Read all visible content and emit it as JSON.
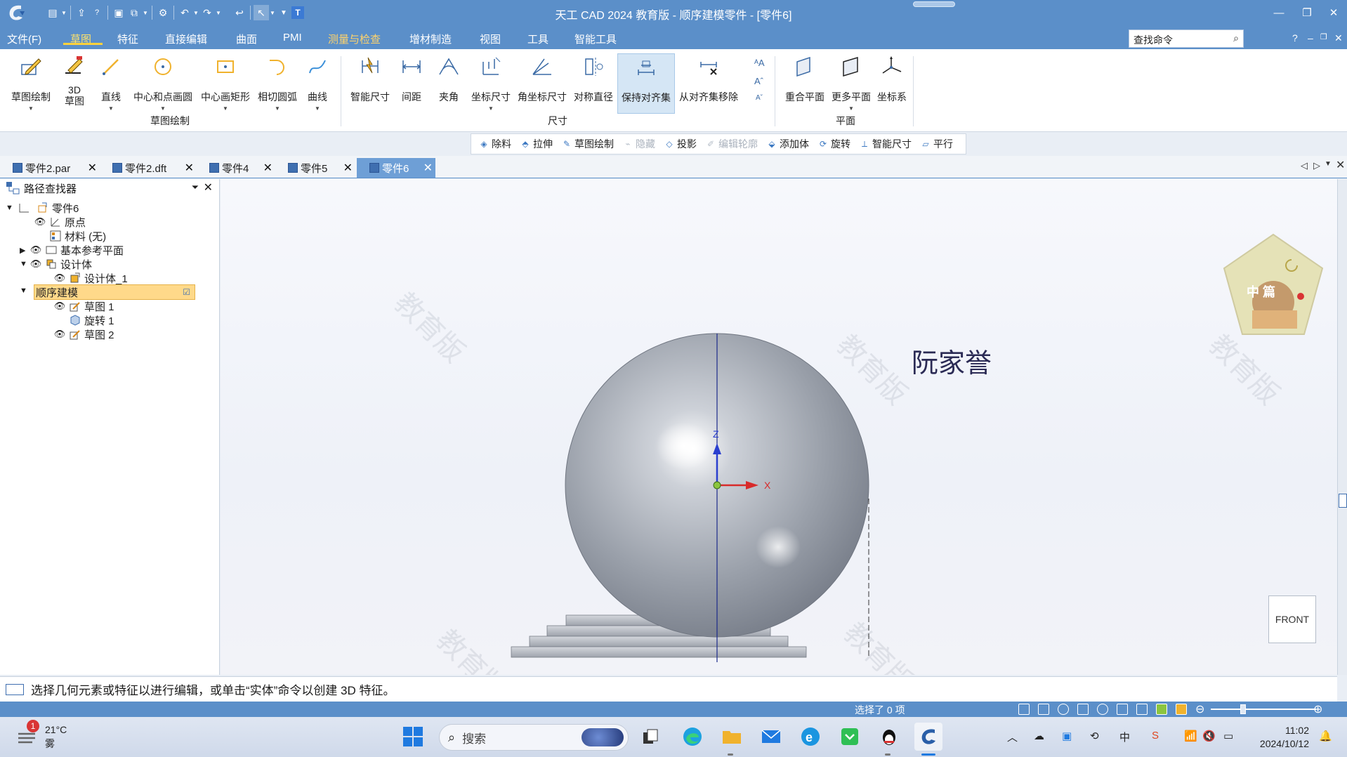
{
  "window": {
    "title": "天工 CAD 2024 教育版 - 顺序建模零件 - [零件6]"
  },
  "menu": {
    "items": [
      {
        "label": "文件(F)"
      },
      {
        "label": "草图"
      },
      {
        "label": "特征"
      },
      {
        "label": "直接编辑"
      },
      {
        "label": "曲面"
      },
      {
        "label": "PMI"
      },
      {
        "label": "测量与检查"
      },
      {
        "label": "增材制造"
      },
      {
        "label": "视图"
      },
      {
        "label": "工具"
      },
      {
        "label": "智能工具"
      }
    ],
    "search_placeholder": "查找命令",
    "help": "?"
  },
  "ribbon": {
    "sketch_group": {
      "label": "草图绘制",
      "buttons": [
        {
          "label": "草图绘制"
        },
        {
          "label": "3D\n草图"
        },
        {
          "label": "直线"
        },
        {
          "label": "中心和点画圆"
        },
        {
          "label": "中心画矩形"
        },
        {
          "label": "相切圆弧"
        },
        {
          "label": "曲线"
        }
      ]
    },
    "dimension_group": {
      "label": "尺寸",
      "buttons": [
        {
          "label": "智能尺寸"
        },
        {
          "label": "间距"
        },
        {
          "label": "夹角"
        },
        {
          "label": "坐标尺寸"
        },
        {
          "label": "角坐标尺寸"
        },
        {
          "label": "对称直径"
        },
        {
          "label": "保持对齐集"
        },
        {
          "label": "从对齐集移除"
        }
      ]
    },
    "plane_group": {
      "label": "平面",
      "buttons": [
        {
          "label": "重合平面"
        },
        {
          "label": "更多平面"
        },
        {
          "label": "坐标系"
        }
      ]
    }
  },
  "context_toolbar": {
    "items": [
      {
        "label": "除料",
        "enabled": true
      },
      {
        "label": "拉伸",
        "enabled": true
      },
      {
        "label": "草图绘制",
        "enabled": true
      },
      {
        "label": "隐藏",
        "enabled": false
      },
      {
        "label": "投影",
        "enabled": true
      },
      {
        "label": "编辑轮廓",
        "enabled": false
      },
      {
        "label": "添加体",
        "enabled": true
      },
      {
        "label": "旋转",
        "enabled": true
      },
      {
        "label": "智能尺寸",
        "enabled": true
      },
      {
        "label": "平行",
        "enabled": true
      }
    ]
  },
  "doc_tabs": [
    {
      "label": "零件2.par",
      "active": false
    },
    {
      "label": "零件2.dft",
      "active": false
    },
    {
      "label": "零件4",
      "active": false
    },
    {
      "label": "零件5",
      "active": false
    },
    {
      "label": "零件6",
      "active": true
    }
  ],
  "pathfinder": {
    "title": "路径查找器",
    "nodes": [
      {
        "label": "零件6"
      },
      {
        "label": "原点"
      },
      {
        "label": "材料 (无)"
      },
      {
        "label": "基本参考平面"
      },
      {
        "label": "设计体"
      },
      {
        "label": "设计体_1"
      },
      {
        "label": "顺序建模"
      },
      {
        "label": "草图 1"
      },
      {
        "label": "旋转 1"
      },
      {
        "label": "草图 2"
      }
    ]
  },
  "viewport": {
    "watermark": "教育版",
    "annotation_text": "阮家誉",
    "axis_z": "Z",
    "axis_x": "X",
    "view_cube_label": "FRONT",
    "badge_text": "中 篇"
  },
  "status": {
    "prompt": "选择几何元素或特征以进行编辑，或单击“实体”命令以创建 3D 特征。",
    "selection": "选择了 0 项"
  },
  "taskbar": {
    "weather_temp": "21°C",
    "weather_desc": "雾",
    "weather_badge": "1",
    "search_label": "搜索",
    "ime": "中",
    "time": "11:02",
    "date": "2024/10/12"
  },
  "colors": {
    "accent": "#5b8fc9",
    "active_menu": "#ffe36b",
    "selected_tree": "#ffd98a"
  }
}
